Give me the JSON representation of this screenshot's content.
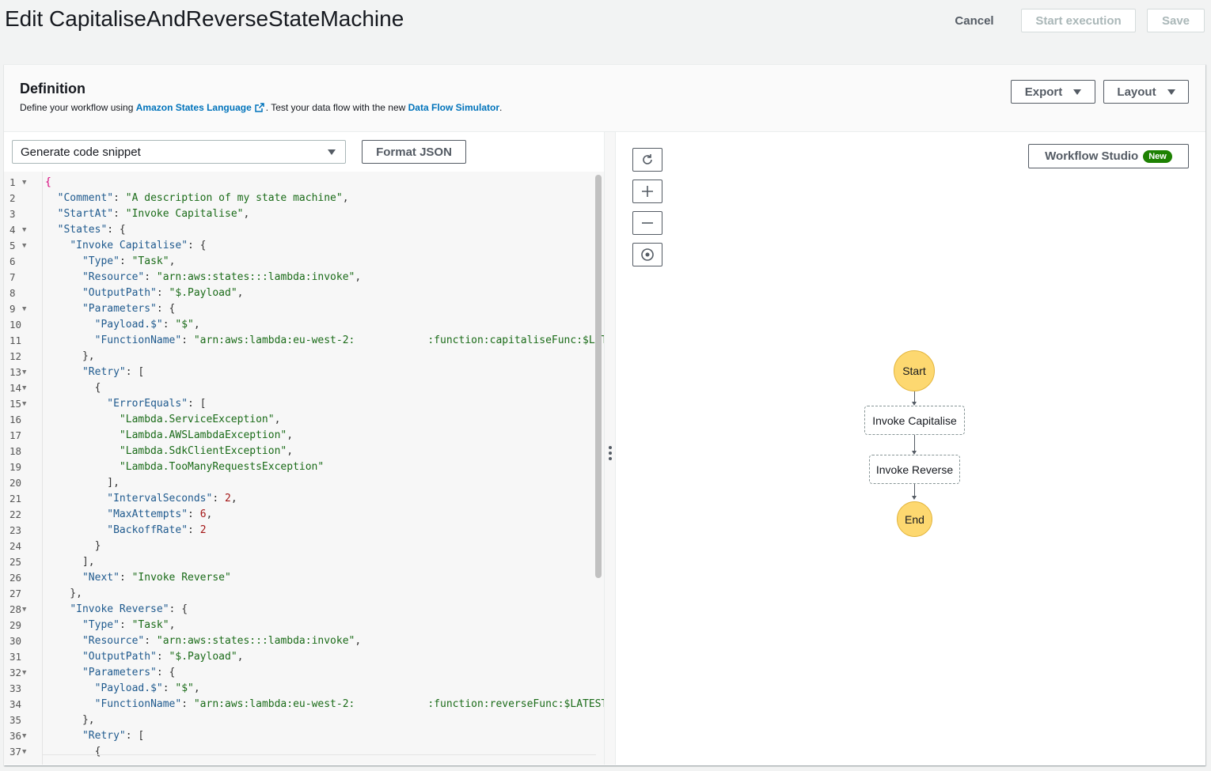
{
  "page": {
    "title": "Edit CapitaliseAndReverseStateMachine",
    "actions": {
      "cancel": "Cancel",
      "start_execution": "Start execution",
      "save": "Save"
    }
  },
  "definition": {
    "title": "Definition",
    "desc_prefix": "Define your workflow using ",
    "asl_link": "Amazon States Language",
    "desc_middle": ". Test your data flow with the new ",
    "simulator_link": "Data Flow Simulator",
    "desc_suffix": ".",
    "export_label": "Export",
    "layout_label": "Layout"
  },
  "editor": {
    "snippet_select": "Generate code snippet",
    "format_json": "Format JSON",
    "lines": [
      {
        "n": "1",
        "fold": true,
        "segments": [
          [
            "b",
            "{"
          ]
        ]
      },
      {
        "n": "2",
        "fold": false,
        "segments": [
          [
            "p",
            "  "
          ],
          [
            "k",
            "\"Comment\""
          ],
          [
            "p",
            ": "
          ],
          [
            "s",
            "\"A description of my state machine\""
          ],
          [
            "p",
            ","
          ]
        ]
      },
      {
        "n": "3",
        "fold": false,
        "segments": [
          [
            "p",
            "  "
          ],
          [
            "k",
            "\"StartAt\""
          ],
          [
            "p",
            ": "
          ],
          [
            "s",
            "\"Invoke Capitalise\""
          ],
          [
            "p",
            ","
          ]
        ]
      },
      {
        "n": "4",
        "fold": true,
        "segments": [
          [
            "p",
            "  "
          ],
          [
            "k",
            "\"States\""
          ],
          [
            "p",
            ": {"
          ]
        ]
      },
      {
        "n": "5",
        "fold": true,
        "segments": [
          [
            "p",
            "    "
          ],
          [
            "k",
            "\"Invoke Capitalise\""
          ],
          [
            "p",
            ": {"
          ]
        ]
      },
      {
        "n": "6",
        "fold": false,
        "segments": [
          [
            "p",
            "      "
          ],
          [
            "k",
            "\"Type\""
          ],
          [
            "p",
            ": "
          ],
          [
            "s",
            "\"Task\""
          ],
          [
            "p",
            ","
          ]
        ]
      },
      {
        "n": "7",
        "fold": false,
        "segments": [
          [
            "p",
            "      "
          ],
          [
            "k",
            "\"Resource\""
          ],
          [
            "p",
            ": "
          ],
          [
            "s",
            "\"arn:aws:states:::lambda:invoke\""
          ],
          [
            "p",
            ","
          ]
        ]
      },
      {
        "n": "8",
        "fold": false,
        "segments": [
          [
            "p",
            "      "
          ],
          [
            "k",
            "\"OutputPath\""
          ],
          [
            "p",
            ": "
          ],
          [
            "s",
            "\"$.Payload\""
          ],
          [
            "p",
            ","
          ]
        ]
      },
      {
        "n": "9",
        "fold": true,
        "segments": [
          [
            "p",
            "      "
          ],
          [
            "k",
            "\"Parameters\""
          ],
          [
            "p",
            ": {"
          ]
        ]
      },
      {
        "n": "10",
        "fold": false,
        "segments": [
          [
            "p",
            "        "
          ],
          [
            "k",
            "\"Payload.$\""
          ],
          [
            "p",
            ": "
          ],
          [
            "s",
            "\"$\""
          ],
          [
            "p",
            ","
          ]
        ]
      },
      {
        "n": "11",
        "fold": false,
        "segments": [
          [
            "p",
            "        "
          ],
          [
            "k",
            "\"FunctionName\""
          ],
          [
            "p",
            ": "
          ],
          [
            "s",
            "\"arn:aws:lambda:eu-west-2:"
          ],
          [
            "r",
            ""
          ],
          [
            "s",
            ":function:capitaliseFunc:$LATEST\""
          ]
        ]
      },
      {
        "n": "12",
        "fold": false,
        "segments": [
          [
            "p",
            "      },"
          ]
        ]
      },
      {
        "n": "13",
        "fold": true,
        "segments": [
          [
            "p",
            "      "
          ],
          [
            "k",
            "\"Retry\""
          ],
          [
            "p",
            ": ["
          ]
        ]
      },
      {
        "n": "14",
        "fold": true,
        "segments": [
          [
            "p",
            "        {"
          ]
        ]
      },
      {
        "n": "15",
        "fold": true,
        "segments": [
          [
            "p",
            "          "
          ],
          [
            "k",
            "\"ErrorEquals\""
          ],
          [
            "p",
            ": ["
          ]
        ]
      },
      {
        "n": "16",
        "fold": false,
        "segments": [
          [
            "p",
            "            "
          ],
          [
            "s",
            "\"Lambda.ServiceException\""
          ],
          [
            "p",
            ","
          ]
        ]
      },
      {
        "n": "17",
        "fold": false,
        "segments": [
          [
            "p",
            "            "
          ],
          [
            "s",
            "\"Lambda.AWSLambdaException\""
          ],
          [
            "p",
            ","
          ]
        ]
      },
      {
        "n": "18",
        "fold": false,
        "segments": [
          [
            "p",
            "            "
          ],
          [
            "s",
            "\"Lambda.SdkClientException\""
          ],
          [
            "p",
            ","
          ]
        ]
      },
      {
        "n": "19",
        "fold": false,
        "segments": [
          [
            "p",
            "            "
          ],
          [
            "s",
            "\"Lambda.TooManyRequestsException\""
          ]
        ]
      },
      {
        "n": "20",
        "fold": false,
        "segments": [
          [
            "p",
            "          ],"
          ]
        ]
      },
      {
        "n": "21",
        "fold": false,
        "segments": [
          [
            "p",
            "          "
          ],
          [
            "k",
            "\"IntervalSeconds\""
          ],
          [
            "p",
            ": "
          ],
          [
            "n",
            "2"
          ],
          [
            "p",
            ","
          ]
        ]
      },
      {
        "n": "22",
        "fold": false,
        "segments": [
          [
            "p",
            "          "
          ],
          [
            "k",
            "\"MaxAttempts\""
          ],
          [
            "p",
            ": "
          ],
          [
            "n",
            "6"
          ],
          [
            "p",
            ","
          ]
        ]
      },
      {
        "n": "23",
        "fold": false,
        "segments": [
          [
            "p",
            "          "
          ],
          [
            "k",
            "\"BackoffRate\""
          ],
          [
            "p",
            ": "
          ],
          [
            "n",
            "2"
          ]
        ]
      },
      {
        "n": "24",
        "fold": false,
        "segments": [
          [
            "p",
            "        }"
          ]
        ]
      },
      {
        "n": "25",
        "fold": false,
        "segments": [
          [
            "p",
            "      ],"
          ]
        ]
      },
      {
        "n": "26",
        "fold": false,
        "segments": [
          [
            "p",
            "      "
          ],
          [
            "k",
            "\"Next\""
          ],
          [
            "p",
            ": "
          ],
          [
            "s",
            "\"Invoke Reverse\""
          ]
        ]
      },
      {
        "n": "27",
        "fold": false,
        "segments": [
          [
            "p",
            "    },"
          ]
        ]
      },
      {
        "n": "28",
        "fold": true,
        "segments": [
          [
            "p",
            "    "
          ],
          [
            "k",
            "\"Invoke Reverse\""
          ],
          [
            "p",
            ": {"
          ]
        ]
      },
      {
        "n": "29",
        "fold": false,
        "segments": [
          [
            "p",
            "      "
          ],
          [
            "k",
            "\"Type\""
          ],
          [
            "p",
            ": "
          ],
          [
            "s",
            "\"Task\""
          ],
          [
            "p",
            ","
          ]
        ]
      },
      {
        "n": "30",
        "fold": false,
        "segments": [
          [
            "p",
            "      "
          ],
          [
            "k",
            "\"Resource\""
          ],
          [
            "p",
            ": "
          ],
          [
            "s",
            "\"arn:aws:states:::lambda:invoke\""
          ],
          [
            "p",
            ","
          ]
        ]
      },
      {
        "n": "31",
        "fold": false,
        "segments": [
          [
            "p",
            "      "
          ],
          [
            "k",
            "\"OutputPath\""
          ],
          [
            "p",
            ": "
          ],
          [
            "s",
            "\"$.Payload\""
          ],
          [
            "p",
            ","
          ]
        ]
      },
      {
        "n": "32",
        "fold": true,
        "segments": [
          [
            "p",
            "      "
          ],
          [
            "k",
            "\"Parameters\""
          ],
          [
            "p",
            ": {"
          ]
        ]
      },
      {
        "n": "33",
        "fold": false,
        "segments": [
          [
            "p",
            "        "
          ],
          [
            "k",
            "\"Payload.$\""
          ],
          [
            "p",
            ": "
          ],
          [
            "s",
            "\"$\""
          ],
          [
            "p",
            ","
          ]
        ]
      },
      {
        "n": "34",
        "fold": false,
        "segments": [
          [
            "p",
            "        "
          ],
          [
            "k",
            "\"FunctionName\""
          ],
          [
            "p",
            ": "
          ],
          [
            "s",
            "\"arn:aws:lambda:eu-west-2:"
          ],
          [
            "r",
            ""
          ],
          [
            "s",
            ":function:reverseFunc:$LATEST\""
          ]
        ]
      },
      {
        "n": "35",
        "fold": false,
        "segments": [
          [
            "p",
            "      },"
          ]
        ]
      },
      {
        "n": "36",
        "fold": true,
        "segments": [
          [
            "p",
            "      "
          ],
          [
            "k",
            "\"Retry\""
          ],
          [
            "p",
            ": ["
          ]
        ]
      },
      {
        "n": "37",
        "fold": true,
        "segments": [
          [
            "p",
            "        {"
          ]
        ]
      }
    ]
  },
  "graph": {
    "workflow_studio": "Workflow Studio",
    "new_badge": "New",
    "tools": [
      "refresh-icon",
      "zoom-in-icon",
      "zoom-out-icon",
      "center-icon"
    ],
    "nodes": {
      "start": "Start",
      "invoke_capitalise": "Invoke Capitalise",
      "invoke_reverse": "Invoke Reverse",
      "end": "End"
    }
  },
  "colors": {
    "link": "#0073bb",
    "node_fill": "#fdd870",
    "badge": "#1d8102",
    "key": "#1f5a8e",
    "string": "#1a6b18",
    "number": "#a31515"
  }
}
